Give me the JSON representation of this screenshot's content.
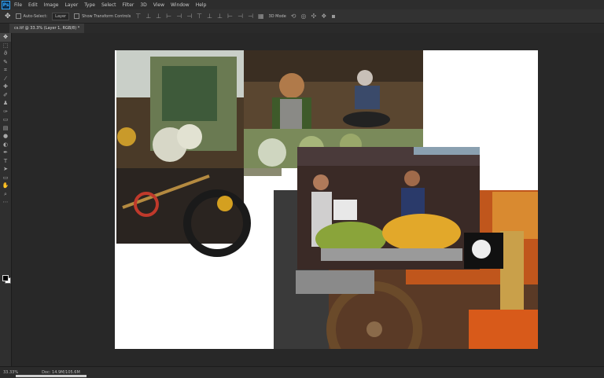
{
  "app": {
    "icon": "Ps"
  },
  "menu": [
    "File",
    "Edit",
    "Image",
    "Layer",
    "Type",
    "Select",
    "Filter",
    "3D",
    "View",
    "Window",
    "Help"
  ],
  "options": {
    "tool_icon": "move-tool-icon",
    "auto_select": "Auto-Select:",
    "layer_select": "Layer",
    "transform_controls": "Show Transform Controls",
    "mode_3d": "3D Mode"
  },
  "document": {
    "tab_title": "cs.tif @ 33.3% (Layer 1, RGB/8) *"
  },
  "tools": [
    "move-icon",
    "marquee-icon",
    "lasso-icon",
    "quick-select-icon",
    "crop-icon",
    "eyedropper-icon",
    "healing-icon",
    "brush-icon",
    "clone-icon",
    "history-brush-icon",
    "eraser-icon",
    "gradient-icon",
    "blur-icon",
    "dodge-icon",
    "pen-icon",
    "type-icon",
    "path-select-icon",
    "shape-icon",
    "hand-icon",
    "zoom-icon",
    "more-icon"
  ],
  "status": {
    "zoom": "33.33%",
    "doc": "Doc: 14.9M/105.6M"
  },
  "colors": {
    "chrome": "#323232",
    "canvas": "#ffffff",
    "accent": "#31a8ff"
  }
}
